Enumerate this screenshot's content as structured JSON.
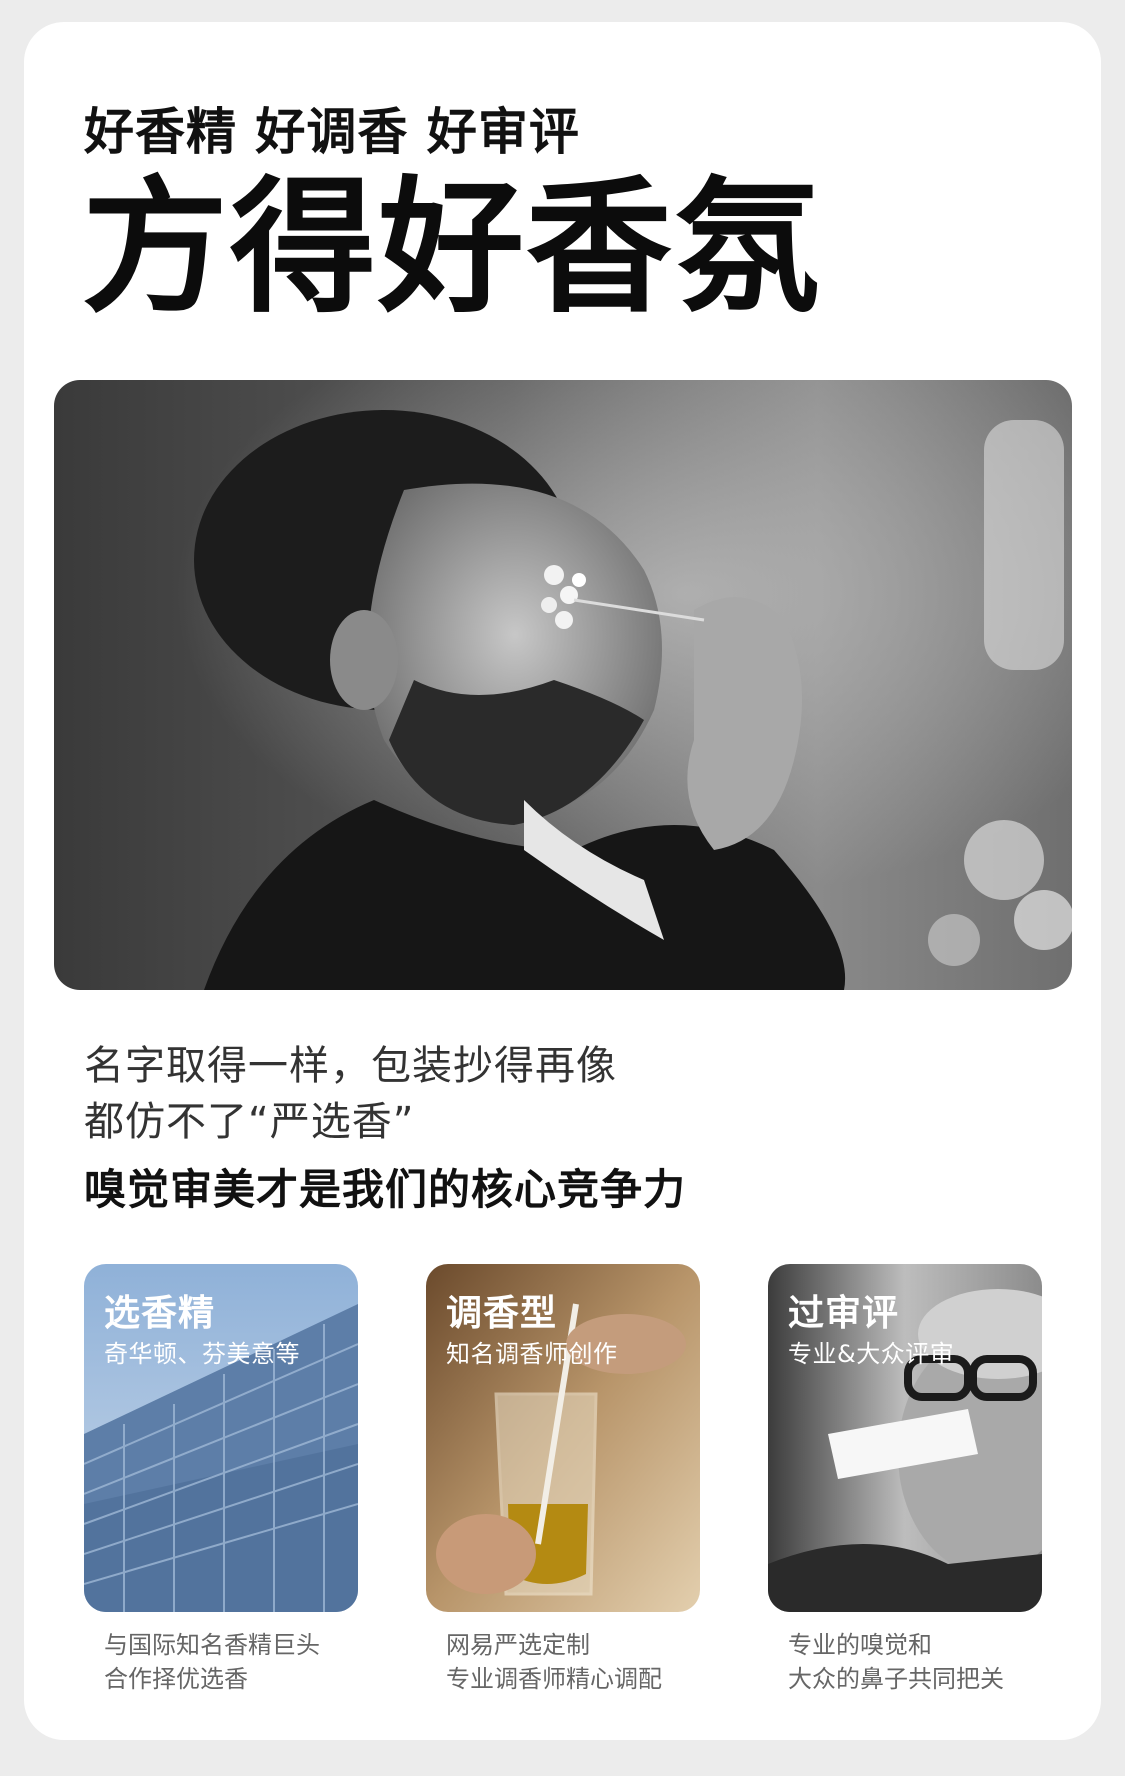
{
  "header": {
    "subtitle": "好香精 好调香 好审评",
    "headline": "方得好香氛"
  },
  "hero": {
    "image_alt": "man smelling small white flowers, black and white photo"
  },
  "copy": {
    "line1": "名字取得一样，包装抄得再像",
    "line2": "都仿不了“严选香”",
    "emphasis": "嗅觉审美才是我们的核心竞争力"
  },
  "features": [
    {
      "title": "选香精",
      "subtitle": "奇华顿、芬美意等",
      "desc_line1": "与国际知名香精巨头",
      "desc_line2": "合作择优选香",
      "tile_color": "#6f8fb6"
    },
    {
      "title": "调香型",
      "subtitle": "知名调香师创作",
      "desc_line1": "网易严选定制",
      "desc_line2": "专业调香师精心调配",
      "tile_color": "#a9825a"
    },
    {
      "title": "过审评",
      "subtitle": "专业&大众评审",
      "desc_line1": "专业的嗅觉和",
      "desc_line2": "大众的鼻子共同把关",
      "tile_color": "#6e6e6e"
    }
  ]
}
